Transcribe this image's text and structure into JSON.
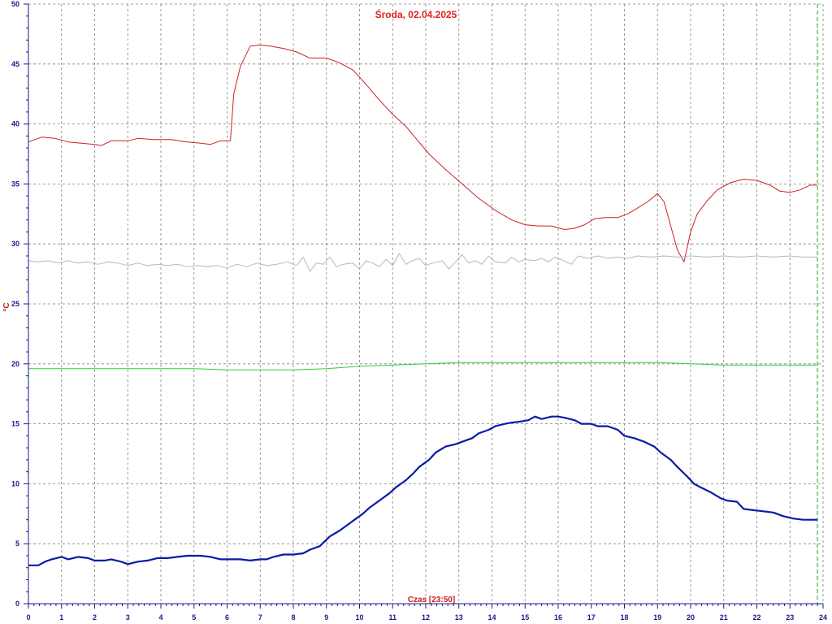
{
  "chart_data": {
    "type": "line",
    "title": "Środa, 02.04.2025",
    "xlabel": "Czas [23:50]",
    "ylabel": "°C",
    "xlim": [
      0,
      24
    ],
    "ylim": [
      0,
      50
    ],
    "x_ticks": [
      "0",
      "1",
      "2",
      "3",
      "4",
      "5",
      "6",
      "7",
      "8",
      "9",
      "10",
      "11",
      "12",
      "13",
      "14",
      "15",
      "16",
      "17",
      "18",
      "19",
      "20",
      "21",
      "22",
      "23",
      "24"
    ],
    "y_ticks": [
      "0",
      "5",
      "10",
      "15",
      "20",
      "25",
      "30",
      "35",
      "40",
      "45",
      "50"
    ],
    "grid": true,
    "current_time_marker": 23.83,
    "colors": {
      "grid": "#808080",
      "axis": "#1a1a8c",
      "marker": "#2a9a2a"
    },
    "series": [
      {
        "color": "#cc2020",
        "width": 1,
        "points": [
          [
            0,
            38.5
          ],
          [
            0.4,
            38.9
          ],
          [
            0.8,
            38.8
          ],
          [
            1.2,
            38.5
          ],
          [
            1.6,
            38.4
          ],
          [
            2,
            38.3
          ],
          [
            2.2,
            38.2
          ],
          [
            2.5,
            38.6
          ],
          [
            3,
            38.6
          ],
          [
            3.3,
            38.8
          ],
          [
            3.8,
            38.7
          ],
          [
            4.3,
            38.7
          ],
          [
            4.8,
            38.5
          ],
          [
            5.2,
            38.4
          ],
          [
            5.5,
            38.3
          ],
          [
            5.8,
            38.6
          ],
          [
            6.1,
            38.6
          ],
          [
            6.2,
            42.5
          ],
          [
            6.4,
            44.8
          ],
          [
            6.7,
            46.5
          ],
          [
            7,
            46.6
          ],
          [
            7.3,
            46.5
          ],
          [
            7.7,
            46.3
          ],
          [
            8.1,
            46
          ],
          [
            8.5,
            45.5
          ],
          [
            9,
            45.5
          ],
          [
            9.4,
            45.1
          ],
          [
            9.8,
            44.5
          ],
          [
            10.2,
            43.3
          ],
          [
            10.6,
            42
          ],
          [
            11,
            40.8
          ],
          [
            11.4,
            39.8
          ],
          [
            11.7,
            38.8
          ],
          [
            12.1,
            37.5
          ],
          [
            12.6,
            36.2
          ],
          [
            13.1,
            35
          ],
          [
            13.6,
            33.8
          ],
          [
            14.1,
            32.8
          ],
          [
            14.6,
            32
          ],
          [
            15,
            31.6
          ],
          [
            15.4,
            31.5
          ],
          [
            15.8,
            31.5
          ],
          [
            16.2,
            31.2
          ],
          [
            16.5,
            31.3
          ],
          [
            16.8,
            31.6
          ],
          [
            17.1,
            32.1
          ],
          [
            17.4,
            32.2
          ],
          [
            17.8,
            32.2
          ],
          [
            18.1,
            32.5
          ],
          [
            18.4,
            33
          ],
          [
            18.7,
            33.5
          ],
          [
            19,
            34.2
          ],
          [
            19.2,
            33.5
          ],
          [
            19.4,
            31.5
          ],
          [
            19.6,
            29.5
          ],
          [
            19.8,
            28.5
          ],
          [
            20,
            31
          ],
          [
            20.2,
            32.5
          ],
          [
            20.5,
            33.6
          ],
          [
            20.8,
            34.5
          ],
          [
            21.2,
            35.1
          ],
          [
            21.6,
            35.4
          ],
          [
            22,
            35.3
          ],
          [
            22.4,
            34.9
          ],
          [
            22.7,
            34.4
          ],
          [
            23,
            34.3
          ],
          [
            23.3,
            34.5
          ],
          [
            23.6,
            34.9
          ],
          [
            23.83,
            34.9
          ]
        ]
      },
      {
        "color": "#b8b8b8",
        "width": 1,
        "points": [
          [
            0,
            28.6
          ],
          [
            0.3,
            28.5
          ],
          [
            0.6,
            28.6
          ],
          [
            0.9,
            28.4
          ],
          [
            1.2,
            28.6
          ],
          [
            1.5,
            28.4
          ],
          [
            1.8,
            28.5
          ],
          [
            2.1,
            28.3
          ],
          [
            2.4,
            28.5
          ],
          [
            2.7,
            28.4
          ],
          [
            3,
            28.2
          ],
          [
            3.3,
            28.4
          ],
          [
            3.6,
            28.2
          ],
          [
            3.9,
            28.3
          ],
          [
            4.2,
            28.2
          ],
          [
            4.5,
            28.3
          ],
          [
            4.8,
            28.1
          ],
          [
            5.1,
            28.2
          ],
          [
            5.4,
            28.1
          ],
          [
            5.7,
            28.2
          ],
          [
            6,
            28
          ],
          [
            6.3,
            28.3
          ],
          [
            6.6,
            28.1
          ],
          [
            6.9,
            28.4
          ],
          [
            7.2,
            28.2
          ],
          [
            7.5,
            28.3
          ],
          [
            7.8,
            28.5
          ],
          [
            8.1,
            28.2
          ],
          [
            8.3,
            28.9
          ],
          [
            8.5,
            27.7
          ],
          [
            8.7,
            28.4
          ],
          [
            8.9,
            28.3
          ],
          [
            9.1,
            28.9
          ],
          [
            9.3,
            28.1
          ],
          [
            9.5,
            28.3
          ],
          [
            9.8,
            28.4
          ],
          [
            10,
            27.9
          ],
          [
            10.2,
            28.6
          ],
          [
            10.4,
            28.4
          ],
          [
            10.6,
            28.1
          ],
          [
            10.8,
            28.7
          ],
          [
            11,
            28.2
          ],
          [
            11.2,
            29.2
          ],
          [
            11.4,
            28.3
          ],
          [
            11.6,
            28.6
          ],
          [
            11.8,
            28.8
          ],
          [
            12,
            28.2
          ],
          [
            12.2,
            28.4
          ],
          [
            12.5,
            28.6
          ],
          [
            12.7,
            27.9
          ],
          [
            12.9,
            28.5
          ],
          [
            13.1,
            29.1
          ],
          [
            13.3,
            28.4
          ],
          [
            13.5,
            28.6
          ],
          [
            13.7,
            28.3
          ],
          [
            13.9,
            29
          ],
          [
            14.1,
            28.5
          ],
          [
            14.4,
            28.4
          ],
          [
            14.6,
            28.9
          ],
          [
            14.8,
            28.5
          ],
          [
            15,
            28.7
          ],
          [
            15.3,
            28.6
          ],
          [
            15.5,
            28.8
          ],
          [
            15.7,
            28.5
          ],
          [
            15.9,
            28.9
          ],
          [
            16.1,
            28.7
          ],
          [
            16.4,
            28.3
          ],
          [
            16.6,
            29
          ],
          [
            16.9,
            28.8
          ],
          [
            17.2,
            29
          ],
          [
            17.5,
            28.8
          ],
          [
            17.8,
            28.9
          ],
          [
            18.1,
            28.8
          ],
          [
            18.4,
            29
          ],
          [
            18.8,
            28.9
          ],
          [
            19.2,
            29
          ],
          [
            19.6,
            28.9
          ],
          [
            20,
            29
          ],
          [
            20.5,
            28.9
          ],
          [
            21,
            29
          ],
          [
            21.5,
            28.9
          ],
          [
            22,
            29
          ],
          [
            22.5,
            28.9
          ],
          [
            23,
            29
          ],
          [
            23.4,
            28.9
          ],
          [
            23.83,
            28.9
          ]
        ]
      },
      {
        "color": "#33cc33",
        "width": 1,
        "points": [
          [
            0,
            19.6
          ],
          [
            1,
            19.6
          ],
          [
            2,
            19.6
          ],
          [
            3,
            19.6
          ],
          [
            4,
            19.6
          ],
          [
            5,
            19.6
          ],
          [
            6,
            19.5
          ],
          [
            7,
            19.5
          ],
          [
            8,
            19.5
          ],
          [
            9,
            19.6
          ],
          [
            10,
            19.8
          ],
          [
            11,
            19.9
          ],
          [
            12,
            20
          ],
          [
            13,
            20.1
          ],
          [
            14,
            20.1
          ],
          [
            15,
            20.1
          ],
          [
            16,
            20.1
          ],
          [
            17,
            20.1
          ],
          [
            18,
            20.1
          ],
          [
            19,
            20.1
          ],
          [
            20,
            20
          ],
          [
            21,
            19.9
          ],
          [
            22,
            19.9
          ],
          [
            23,
            19.9
          ],
          [
            23.83,
            19.9
          ]
        ]
      },
      {
        "color": "#0a1aa8",
        "width": 2.2,
        "points": [
          [
            0,
            3.2
          ],
          [
            0.3,
            3.2
          ],
          [
            0.5,
            3.5
          ],
          [
            0.7,
            3.7
          ],
          [
            1,
            3.9
          ],
          [
            1.2,
            3.7
          ],
          [
            1.5,
            3.9
          ],
          [
            1.8,
            3.8
          ],
          [
            2,
            3.6
          ],
          [
            2.3,
            3.6
          ],
          [
            2.5,
            3.7
          ],
          [
            2.8,
            3.5
          ],
          [
            3,
            3.3
          ],
          [
            3.3,
            3.5
          ],
          [
            3.6,
            3.6
          ],
          [
            3.9,
            3.8
          ],
          [
            4.2,
            3.8
          ],
          [
            4.5,
            3.9
          ],
          [
            4.8,
            4
          ],
          [
            5.2,
            4
          ],
          [
            5.5,
            3.9
          ],
          [
            5.8,
            3.7
          ],
          [
            6.1,
            3.7
          ],
          [
            6.4,
            3.7
          ],
          [
            6.7,
            3.6
          ],
          [
            7,
            3.7
          ],
          [
            7.2,
            3.7
          ],
          [
            7.4,
            3.9
          ],
          [
            7.7,
            4.1
          ],
          [
            8,
            4.1
          ],
          [
            8.3,
            4.2
          ],
          [
            8.5,
            4.5
          ],
          [
            8.8,
            4.8
          ],
          [
            9.1,
            5.6
          ],
          [
            9.4,
            6.1
          ],
          [
            9.6,
            6.5
          ],
          [
            9.9,
            7.1
          ],
          [
            10.1,
            7.5
          ],
          [
            10.3,
            8
          ],
          [
            10.6,
            8.6
          ],
          [
            10.9,
            9.2
          ],
          [
            11.1,
            9.7
          ],
          [
            11.4,
            10.3
          ],
          [
            11.6,
            10.8
          ],
          [
            11.8,
            11.4
          ],
          [
            12.1,
            12
          ],
          [
            12.3,
            12.6
          ],
          [
            12.6,
            13.1
          ],
          [
            12.9,
            13.3
          ],
          [
            13.1,
            13.5
          ],
          [
            13.4,
            13.8
          ],
          [
            13.6,
            14.2
          ],
          [
            13.9,
            14.5
          ],
          [
            14.1,
            14.8
          ],
          [
            14.4,
            15
          ],
          [
            14.6,
            15.1
          ],
          [
            14.9,
            15.2
          ],
          [
            15.1,
            15.3
          ],
          [
            15.3,
            15.6
          ],
          [
            15.5,
            15.4
          ],
          [
            15.8,
            15.6
          ],
          [
            16,
            15.6
          ],
          [
            16.2,
            15.5
          ],
          [
            16.5,
            15.3
          ],
          [
            16.7,
            15
          ],
          [
            17,
            15
          ],
          [
            17.2,
            14.8
          ],
          [
            17.5,
            14.8
          ],
          [
            17.8,
            14.5
          ],
          [
            18,
            14
          ],
          [
            18.3,
            13.8
          ],
          [
            18.6,
            13.5
          ],
          [
            18.9,
            13.1
          ],
          [
            19.1,
            12.6
          ],
          [
            19.4,
            12
          ],
          [
            19.6,
            11.4
          ],
          [
            19.9,
            10.6
          ],
          [
            20.1,
            10
          ],
          [
            20.3,
            9.7
          ],
          [
            20.6,
            9.3
          ],
          [
            20.9,
            8.8
          ],
          [
            21.1,
            8.6
          ],
          [
            21.4,
            8.5
          ],
          [
            21.6,
            7.9
          ],
          [
            21.9,
            7.8
          ],
          [
            22.2,
            7.7
          ],
          [
            22.5,
            7.6
          ],
          [
            22.8,
            7.3
          ],
          [
            23.1,
            7.1
          ],
          [
            23.4,
            7
          ],
          [
            23.83,
            7
          ]
        ]
      }
    ]
  }
}
